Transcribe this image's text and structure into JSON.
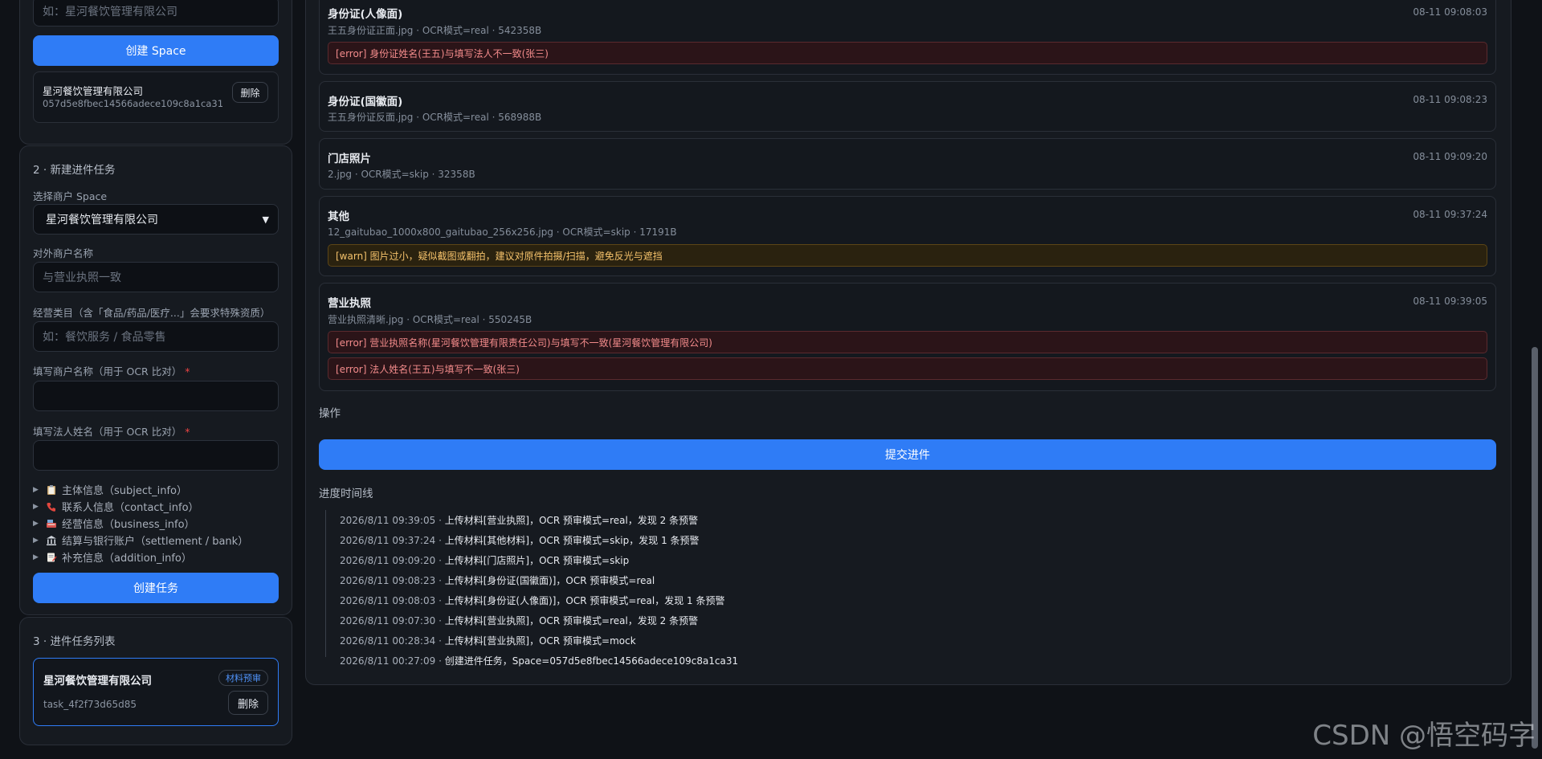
{
  "space": {
    "name_placeholder": "如：星河餐饮管理有限公司",
    "create_button": "创建 Space",
    "card": {
      "name": "星河餐饮管理有限公司",
      "id": "057d5e8fbec14566adece109c8a1ca31",
      "delete_button": "删除"
    }
  },
  "new_task": {
    "title": "2 · 新建进件任务",
    "select_space_label": "选择商户 Space",
    "select_space_value": "星河餐饮管理有限公司",
    "merchant_name_label": "对外商户名称",
    "merchant_name_placeholder": "与营业执照一致",
    "category_label": "经营类目（含「食品/药品/医疗...」会要求特殊资质）",
    "category_placeholder": "如：餐饮服务 / 食品零售",
    "ocr_name_label": "填写商户名称（用于 OCR 比对）",
    "ocr_legal_label": "填写法人姓名（用于 OCR 比对）",
    "required_mark": "*",
    "sections": [
      {
        "icon": "clipboard-icon",
        "label": "主体信息（subject_info）"
      },
      {
        "icon": "phone-icon",
        "label": "联系人信息（contact_info）"
      },
      {
        "icon": "cash-register-icon",
        "label": "经营信息（business_info）"
      },
      {
        "icon": "bank-icon",
        "label": "结算与银行账户（settlement / bank）"
      },
      {
        "icon": "memo-icon",
        "label": "补充信息（addition_info）"
      }
    ],
    "create_button": "创建任务"
  },
  "task_list": {
    "title": "3 · 进件任务列表",
    "items": [
      {
        "name": "星河餐饮管理有限公司",
        "badge": "材料预审",
        "id": "task_4f2f73d65d85",
        "delete_button": "删除"
      }
    ]
  },
  "documents": [
    {
      "title": "身份证(人像面)",
      "sub": "王五身份证正面.jpg · OCR模式=real · 542358B",
      "time": "08-11 09:08:03",
      "alerts": [
        {
          "level": "err",
          "text": "[error] 身份证姓名(王五)与填写法人不一致(张三)"
        }
      ]
    },
    {
      "title": "身份证(国徽面)",
      "sub": "王五身份证反面.jpg · OCR模式=real · 568988B",
      "time": "08-11 09:08:23",
      "alerts": []
    },
    {
      "title": "门店照片",
      "sub": "2.jpg · OCR模式=skip · 32358B",
      "time": "08-11 09:09:20",
      "alerts": []
    },
    {
      "title": "其他",
      "sub": "12_gaitubao_1000x800_gaitubao_256x256.jpg · OCR模式=skip · 17191B",
      "time": "08-11 09:37:24",
      "alerts": [
        {
          "level": "warn",
          "text": "[warn] 图片过小，疑似截图或翻拍，建议对原件拍摄/扫描，避免反光与遮挡"
        }
      ]
    },
    {
      "title": "营业执照",
      "sub": "营业执照清晰.jpg · OCR模式=real · 550245B",
      "time": "08-11 09:39:05",
      "alerts": [
        {
          "level": "err",
          "text": "[error] 营业执照名称(星河餐饮管理有限责任公司)与填写不一致(星河餐饮管理有限公司)"
        },
        {
          "level": "err",
          "text": "[error] 法人姓名(王五)与填写不一致(张三)"
        }
      ]
    }
  ],
  "operations": {
    "title": "操作",
    "submit_button": "提交进件"
  },
  "timeline": {
    "title": "进度时间线",
    "items": [
      {
        "time": "2026/8/11 09:39:05",
        "text": "上传材料[营业执照]，OCR 预审模式=real，发现 2 条预警"
      },
      {
        "time": "2026/8/11 09:37:24",
        "text": "上传材料[其他材料]，OCR 预审模式=skip，发现 1 条预警"
      },
      {
        "time": "2026/8/11 09:09:20",
        "text": "上传材料[门店照片]，OCR 预审模式=skip"
      },
      {
        "time": "2026/8/11 09:08:23",
        "text": "上传材料[身份证(国徽面)]，OCR 预审模式=real"
      },
      {
        "time": "2026/8/11 09:08:03",
        "text": "上传材料[身份证(人像面)]，OCR 预审模式=real，发现 1 条预警"
      },
      {
        "time": "2026/8/11 09:07:30",
        "text": "上传材料[营业执照]，OCR 预审模式=real，发现 2 条预警"
      },
      {
        "time": "2026/8/11 00:28:34",
        "text": "上传材料[营业执照]，OCR 预审模式=mock"
      },
      {
        "time": "2026/8/11 00:27:09",
        "text": "创建进件任务，Space=057d5e8fbec14566adece109c8a1ca31"
      }
    ],
    "separator": " · "
  },
  "watermark": "CSDN @悟空码字",
  "colors": {
    "accent": "#2f7cf6",
    "error": "#f38b8b",
    "warn": "#f5c26b",
    "background": "#0f1217"
  }
}
